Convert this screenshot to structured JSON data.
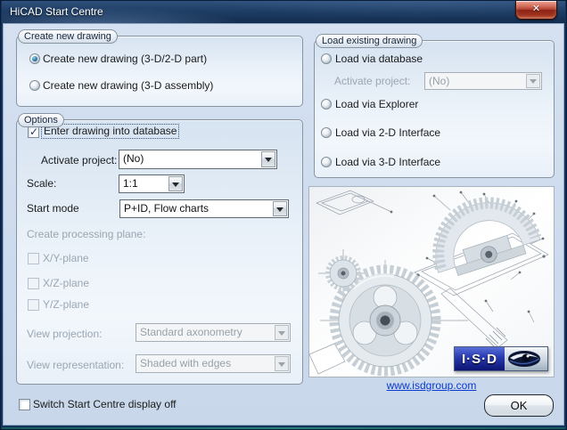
{
  "window": {
    "title": "HiCAD Start Centre",
    "close_glyph": "✕"
  },
  "create_group": {
    "label": "Create new drawing",
    "options": [
      {
        "label": "Create new drawing (3-D/2-D part)",
        "selected": true
      },
      {
        "label": "Create new drawing (3-D assembly)",
        "selected": false
      }
    ]
  },
  "options_group": {
    "label": "Options",
    "enter_db": {
      "label": "Enter drawing into database",
      "checked": true
    },
    "activate_project": {
      "label": "Activate project:",
      "value": "(No)"
    },
    "scale": {
      "label": "Scale:",
      "value": "1:1"
    },
    "start_mode": {
      "label": "Start mode",
      "value": "P+ID, Flow charts"
    },
    "processing_plane": {
      "label": "Create processing plane:",
      "planes": [
        {
          "label": "X/Y-plane",
          "checked": false
        },
        {
          "label": "X/Z-plane",
          "checked": false
        },
        {
          "label": "Y/Z-plane",
          "checked": false
        }
      ]
    },
    "view_projection": {
      "label": "View projection:",
      "value": "Standard axonometry"
    },
    "view_representation": {
      "label": "View representation:",
      "value": "Shaded with edges"
    }
  },
  "load_group": {
    "label": "Load existing drawing",
    "options": [
      {
        "label": "Load via database",
        "selected": false
      },
      {
        "label": "Load via Explorer",
        "selected": false
      },
      {
        "label": "Load via 2-D Interface",
        "selected": false
      },
      {
        "label": "Load via 3-D Interface",
        "selected": false
      }
    ],
    "activate_project": {
      "label": "Activate project:",
      "value": "(No)"
    }
  },
  "preview": {
    "link": "www.isdgroup.com",
    "logo_text": "I·S·D"
  },
  "footer": {
    "switch_off": {
      "label": "Switch Start Centre display off",
      "checked": false
    },
    "ok": "OK"
  },
  "colors": {
    "titlebar": "#1d3b62",
    "close_button": "#b34132",
    "dialog_bg": "#cddbee",
    "group_border": "#8794a2",
    "link": "#0a3ad2",
    "radio_selected": "#2e7cab",
    "logo_blue": "#2638ad"
  }
}
